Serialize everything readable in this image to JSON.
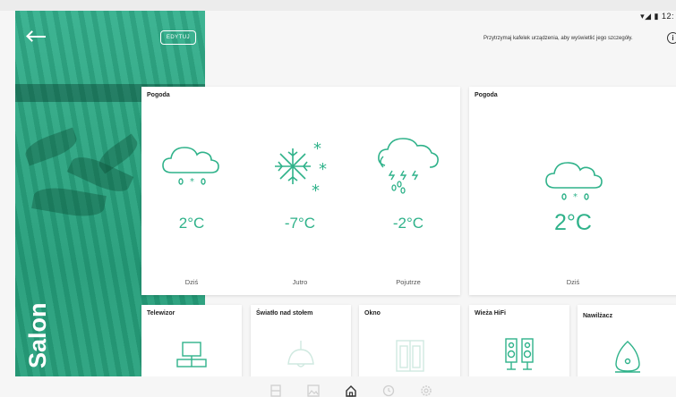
{
  "status_bar": {
    "time": "12:"
  },
  "header": {
    "edit_label": "EDYTUJ",
    "room_name": "Salon",
    "hint": "Przytrzymaj kafelek urządzenia, aby wyświetlić jego szczegóły."
  },
  "weather_large": {
    "title": "Pogoda",
    "days": [
      {
        "temp": "2°C",
        "day": "Dziś",
        "icon": "cloud-snow-icon"
      },
      {
        "temp": "-7°C",
        "day": "Jutro",
        "icon": "snowflake-icon"
      },
      {
        "temp": "-2°C",
        "day": "Pojutrze",
        "icon": "cloud-storm-icon"
      }
    ]
  },
  "weather_small": {
    "title": "Pogoda",
    "temp": "2°C",
    "day": "Dziś",
    "icon": "cloud-snow-icon"
  },
  "devices": [
    {
      "name": "Telewizor",
      "icon": "tv-icon"
    },
    {
      "name": "Światło nad stołem",
      "icon": "lamp-icon"
    },
    {
      "name": "Okno",
      "icon": "window-icon"
    },
    {
      "name": "Wieża HiFi",
      "icon": "speakers-icon"
    },
    {
      "name": "Nawilżacz",
      "icon": "humidifier-icon"
    }
  ],
  "bottom_nav": [
    {
      "icon": "devices-icon"
    },
    {
      "icon": "image-icon"
    },
    {
      "icon": "home-icon",
      "active": true
    },
    {
      "icon": "clock-icon"
    },
    {
      "icon": "settings-icon"
    }
  ],
  "colors": {
    "accent": "#2fb28a",
    "hero": "#2ba37f"
  }
}
